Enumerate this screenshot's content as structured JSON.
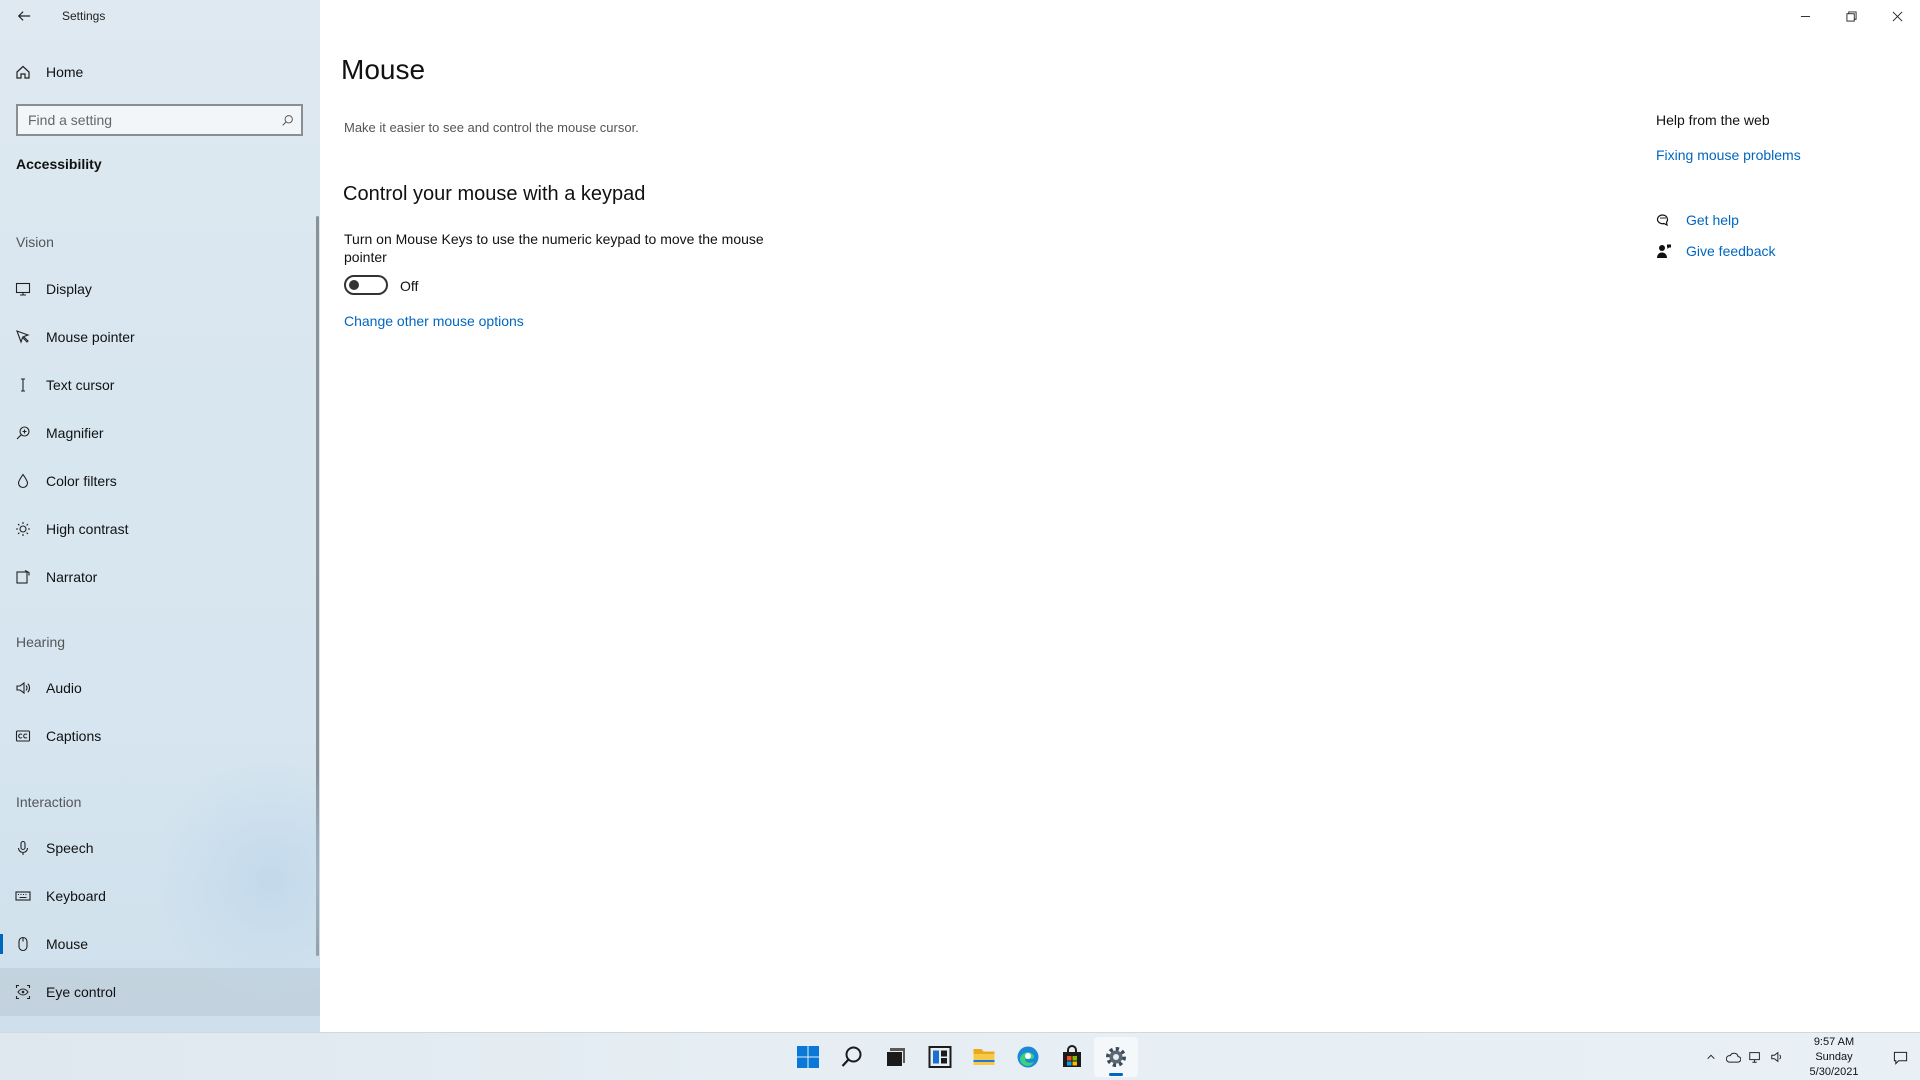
{
  "window": {
    "app_title": "Settings",
    "back_glyph": "←",
    "minimize_glyph": "—",
    "restore_glyph": "❐",
    "close_glyph": "✕"
  },
  "sidebar": {
    "home_label": "Home",
    "search_placeholder": "Find a setting",
    "current_section": "Accessibility",
    "groups": {
      "vision": "Vision",
      "hearing": "Hearing",
      "interaction": "Interaction"
    },
    "items": {
      "display": "Display",
      "mouse_pointer": "Mouse pointer",
      "text_cursor": "Text cursor",
      "magnifier": "Magnifier",
      "color_filters": "Color filters",
      "high_contrast": "High contrast",
      "narrator": "Narrator",
      "audio": "Audio",
      "captions": "Captions",
      "speech": "Speech",
      "keyboard": "Keyboard",
      "mouse": "Mouse",
      "eye_control": "Eye control"
    },
    "selected_item": "Mouse"
  },
  "main": {
    "title": "Mouse",
    "description": "Make it easier to see and control the mouse cursor.",
    "section_title": "Control your mouse with a keypad",
    "mouse_keys_desc": "Turn on Mouse Keys to use the numeric keypad to move the mouse pointer",
    "mouse_keys_state": "Off",
    "change_link": "Change other mouse options"
  },
  "help": {
    "title": "Help from the web",
    "fixing_link": "Fixing mouse problems",
    "get_help": "Get help",
    "give_feedback": "Give feedback"
  },
  "taskbar": {
    "time": "9:57 AM",
    "day": "Sunday",
    "date": "5/30/2021",
    "apps": [
      "start-icon",
      "search-icon",
      "task-view-icon",
      "widgets-icon",
      "file-explorer-icon",
      "edge-icon",
      "store-icon",
      "settings-icon"
    ],
    "active_app": "settings-icon"
  },
  "colors": {
    "accent": "#0067c0",
    "sidebar_bg": "#d8e6ef"
  }
}
